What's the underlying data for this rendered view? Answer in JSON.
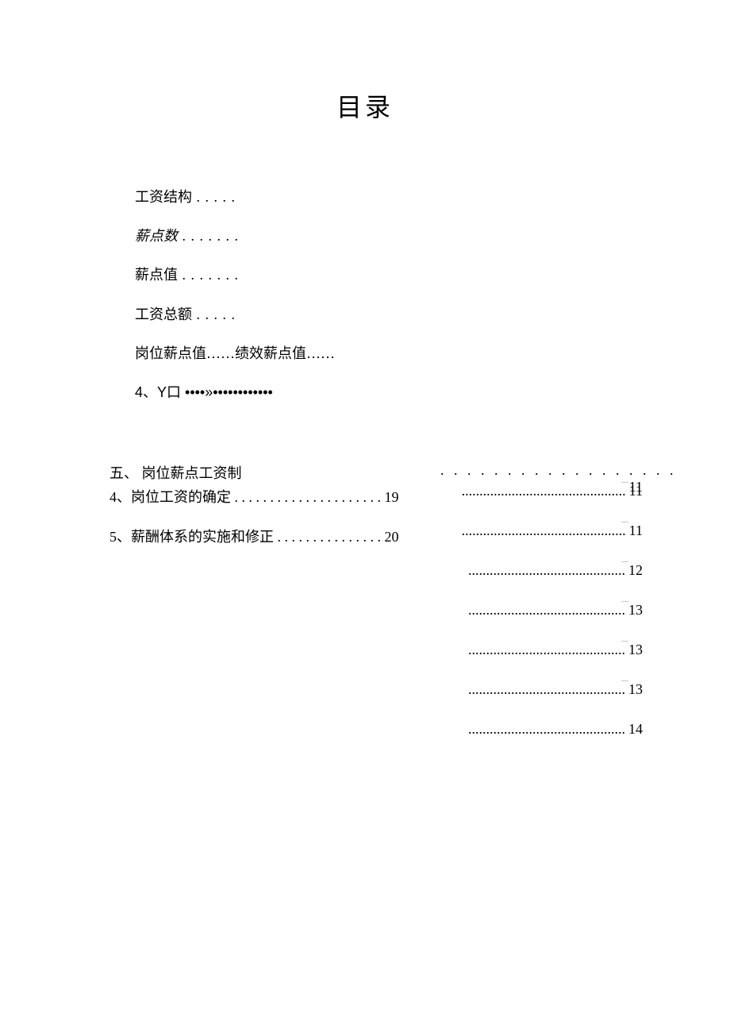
{
  "title": "目录",
  "top_items": [
    {
      "label": "工资结构",
      "trail": " . . . . .",
      "italic": false
    },
    {
      "label": "薪点数",
      "trail": " . . . . . . .",
      "italic": true
    },
    {
      "label": "薪点值",
      "trail": " . . . . . . .",
      "italic": false
    },
    {
      "label": "工资总额",
      "trail": " . . . . .",
      "italic": false
    },
    {
      "label": "岗位薪点值……绩效薪点值……",
      "trail": "",
      "italic": false
    },
    {
      "label": "4、Y口 ••••»••••••••••••",
      "trail": "",
      "italic": false,
      "special": true
    }
  ],
  "left_entries": [
    {
      "text": "五、    岗位薪点工资制"
    },
    {
      "text": "4、岗位工资的确定 . . . . . . . . . . . . . . . . . . . . . 19"
    },
    {
      "text": "5、薪酬体系的实施和修正 . . . . . . . . . . . . . . . 20"
    }
  ],
  "right_entries": [
    {
      "dots": ". . . . . . . . . . . . . . . . . .",
      "page": "11",
      "sparse": true,
      "tiny": false
    },
    {
      "dots": "..............................................",
      "page": "11",
      "sparse": false,
      "tiny": true
    },
    {
      "dots": "..............................................",
      "page": "11",
      "sparse": false,
      "tiny": true
    },
    {
      "dots": "............................................",
      "page": "12",
      "sparse": false,
      "tiny": true
    },
    {
      "dots": "............................................",
      "page": "13",
      "sparse": false,
      "tiny": true
    },
    {
      "dots": "............................................",
      "page": "13",
      "sparse": false,
      "tiny": true
    },
    {
      "dots": "............................................",
      "page": "13",
      "sparse": false,
      "tiny": true
    },
    {
      "dots": "............................................",
      "page": "14",
      "sparse": false,
      "tiny": false
    }
  ]
}
